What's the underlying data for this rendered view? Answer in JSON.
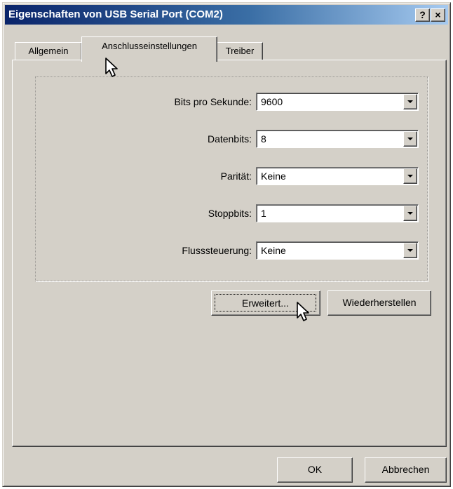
{
  "window": {
    "title": "Eigenschaften von USB Serial Port (COM2)",
    "help_label": "?",
    "close_label": "×"
  },
  "tabs": [
    {
      "label": "Allgemein",
      "active": false
    },
    {
      "label": "Anschlusseinstellungen",
      "active": true
    },
    {
      "label": "Treiber",
      "active": false
    }
  ],
  "settings": {
    "bits_per_second": {
      "label": "Bits pro Sekunde:",
      "value": "9600"
    },
    "data_bits": {
      "label": "Datenbits:",
      "value": "8"
    },
    "parity": {
      "label": "Parität:",
      "value": "Keine"
    },
    "stop_bits": {
      "label": "Stoppbits:",
      "value": "1"
    },
    "flow_control": {
      "label": "Flusssteuerung:",
      "value": "Keine"
    }
  },
  "buttons": {
    "advanced": "Erweitert...",
    "restore": "Wiederherstellen",
    "ok": "OK",
    "cancel": "Abbrechen"
  },
  "icons": {
    "combo_arrow": "chevron-down-icon",
    "cursor": "mouse-pointer-icon"
  },
  "colors": {
    "title_gradient_start": "#0a246a",
    "title_gradient_end": "#a6caf0",
    "face": "#d4d0c8"
  }
}
